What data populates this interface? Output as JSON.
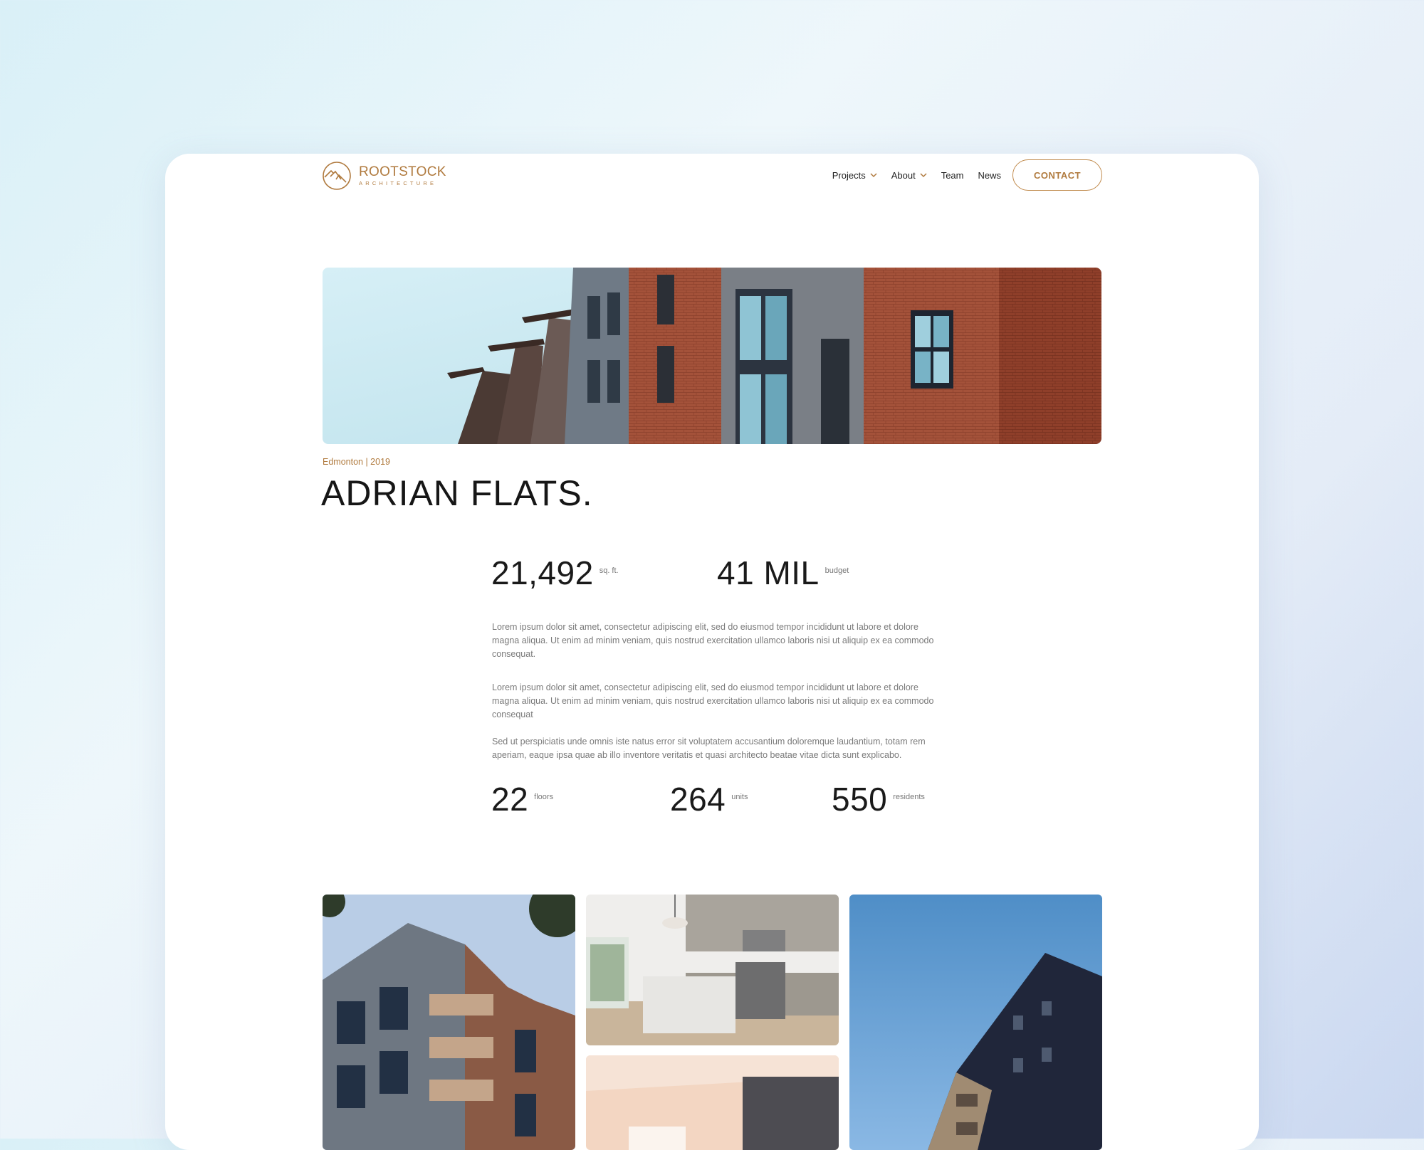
{
  "brand": {
    "name": "ROOTSTOCK",
    "subtitle": "ARCHITECTURE",
    "accent": "#b07a3e"
  },
  "nav": {
    "items": [
      {
        "label": "Projects",
        "has_dropdown": true
      },
      {
        "label": "About",
        "has_dropdown": true
      },
      {
        "label": "Team",
        "has_dropdown": false
      },
      {
        "label": "News",
        "has_dropdown": false
      }
    ],
    "contact_label": "CONTACT"
  },
  "project": {
    "meta": "Edmonton | 2019",
    "title": "ADRIAN FLATS.",
    "area": {
      "value": "21,492",
      "unit": "sq. ft."
    },
    "budget": {
      "value": "41 MIL",
      "unit": "budget"
    },
    "paragraphs": [
      "Lorem ipsum dolor sit amet, consectetur adipiscing elit, sed do eiusmod tempor incididunt ut labore et dolore magna aliqua. Ut enim ad minim veniam, quis nostrud exercitation ullamco laboris nisi ut aliquip ex ea commodo consequat.",
      "Lorem ipsum dolor sit amet, consectetur adipiscing elit, sed do eiusmod tempor incididunt ut labore et dolore magna aliqua. Ut enim ad minim veniam, quis nostrud exercitation ullamco laboris nisi ut aliquip ex ea commodo consequat",
      "Sed ut perspiciatis unde omnis iste natus error sit voluptatem accusantium doloremque laudantium, totam rem aperiam, eaque ipsa quae ab illo inventore veritatis et quasi architecto beatae vitae dicta sunt explicabo."
    ],
    "floors": {
      "value": "22",
      "unit": "floors"
    },
    "units": {
      "value": "264",
      "unit": "units"
    },
    "residents": {
      "value": "550",
      "unit": "residents"
    }
  }
}
